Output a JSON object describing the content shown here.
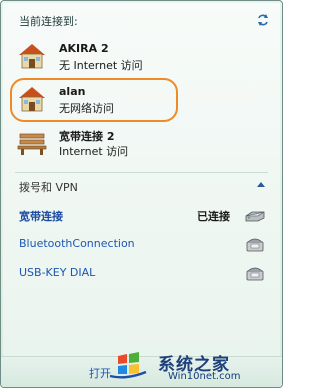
{
  "header": {
    "title": "当前连接到:"
  },
  "networks": [
    {
      "name": "AKIRA  2",
      "status": "无 Internet 访问",
      "icon": "home-network-icon"
    },
    {
      "name": "alan",
      "status": "无网络访问",
      "icon": "home-network-icon",
      "highlighted": true
    },
    {
      "name": "宽带连接  2",
      "status": "Internet 访问",
      "icon": "bench-network-icon"
    }
  ],
  "dialup": {
    "title": "拨号和 VPN",
    "items": [
      {
        "label": "宽带连接",
        "status": "已连接",
        "icon": "modem-icon"
      },
      {
        "label": "BluetoothConnection",
        "status": "",
        "icon": "phone-icon"
      },
      {
        "label": "USB-KEY DIAL",
        "status": "",
        "icon": "phone-icon"
      }
    ]
  },
  "footer": {
    "link": "打开"
  },
  "watermark": {
    "cn": "系统之家",
    "en": "Win10net.com"
  },
  "colors": {
    "highlight": "#f08a28",
    "link": "#1a56b5",
    "panel": "#e3f0e9"
  }
}
